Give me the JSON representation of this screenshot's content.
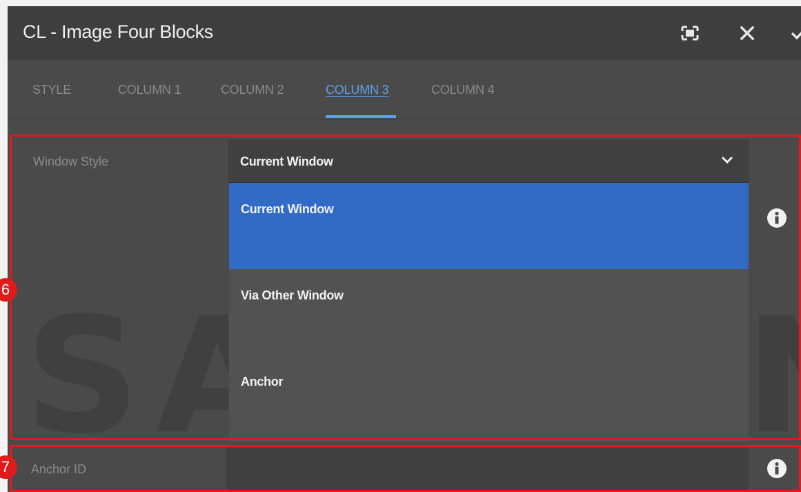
{
  "dialog": {
    "title": "CL - Image Four Blocks",
    "fullscreen_icon": "fullscreen-icon",
    "close_icon": "close-icon",
    "confirm_icon": "checkmark-icon"
  },
  "tabs": [
    {
      "label": "STYLE",
      "active": false
    },
    {
      "label": "COLUMN 1",
      "active": false
    },
    {
      "label": "COLUMN 2",
      "active": false
    },
    {
      "label": "COLUMN 3",
      "active": true
    },
    {
      "label": "COLUMN 4",
      "active": false
    }
  ],
  "window_style": {
    "label": "Window Style",
    "selected": "Current Window",
    "options": [
      "Current Window",
      "Via Other Window",
      "Anchor"
    ],
    "info_icon": "info-icon"
  },
  "anchor_id": {
    "label": "Anchor ID",
    "value": "",
    "info_icon": "info-icon"
  },
  "watermark": "SAMSUNG",
  "annotations": [
    {
      "number": "6"
    },
    {
      "number": "7"
    }
  ],
  "colors": {
    "accent": "#5ea0ee",
    "selected_option": "#316bc6",
    "annotation": "#e01b1b",
    "panel": "#4a4a4a"
  }
}
